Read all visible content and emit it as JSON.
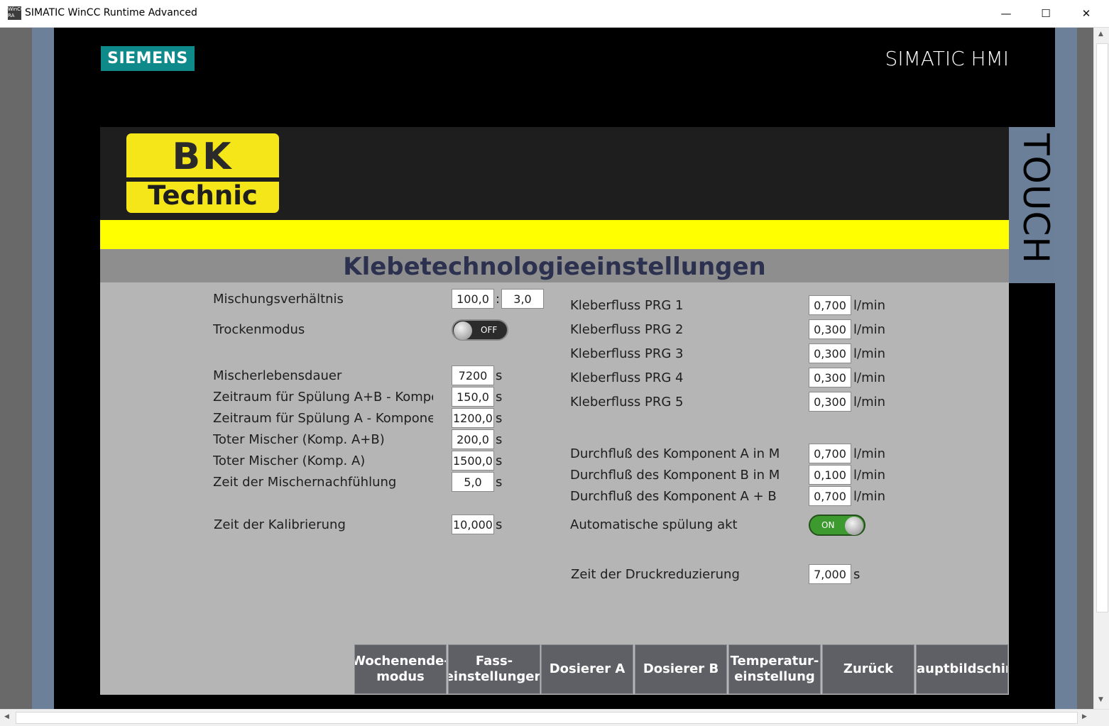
{
  "window": {
    "app_icon_text": "WinCC RA",
    "title": "SIMATIC WinCC Runtime Advanced",
    "minimize": "—",
    "maximize": "☐",
    "close": "✕"
  },
  "panel": {
    "brand": "SIEMENS",
    "product": "SIMATIC HMI",
    "touch_label": "TOUCH"
  },
  "logo": {
    "top": "BK",
    "bottom": "Technic"
  },
  "page_title": "Klebetechnologieeinstellungen",
  "left": {
    "mix_label": "Mischungsverhältnis",
    "mix_a": "100,0",
    "mix_sep": ":",
    "mix_b": "3,0",
    "dry_label": "Trockenmodus",
    "dry_state": "OFF",
    "rows": [
      {
        "label": "Mischerlebensdauer",
        "value": "7200",
        "unit": "s"
      },
      {
        "label": "Zeitraum für Spülung A+B - Kompor",
        "value": "150,0",
        "unit": "s"
      },
      {
        "label": "Zeitraum für Spülung A - Kompone",
        "value": "1200,0",
        "unit": "s"
      },
      {
        "label": "Toter Mischer (Komp. A+B)",
        "value": "200,0",
        "unit": "s"
      },
      {
        "label": "Toter Mischer (Komp. A)",
        "value": "1500,0",
        "unit": "s"
      },
      {
        "label": "Zeit der Mischernachfühlung",
        "value": "5,0",
        "unit": "s"
      }
    ],
    "calib_label": "Zeit der Kalibrierung",
    "calib_value": "10,000",
    "calib_unit": "s"
  },
  "right": {
    "flows": [
      {
        "label": "Kleberfluss PRG 1",
        "value": "0,700",
        "unit": "l/min"
      },
      {
        "label": "Kleberfluss PRG 2",
        "value": "0,300",
        "unit": "l/min"
      },
      {
        "label": "Kleberfluss PRG 3",
        "value": "0,300",
        "unit": "l/min"
      },
      {
        "label": "Kleberfluss PRG 4",
        "value": "0,300",
        "unit": "l/min"
      },
      {
        "label": "Kleberfluss PRG 5",
        "value": "0,300",
        "unit": "l/min"
      }
    ],
    "through": [
      {
        "label": "Durchfluß des Komponent A in Mar",
        "value": "0,700",
        "unit": "l/min"
      },
      {
        "label": "Durchfluß des Komponent B in Mar",
        "value": "0,100",
        "unit": "l/min"
      },
      {
        "label": "Durchfluß des Komponent A + B in",
        "value": "0,700",
        "unit": "l/min"
      }
    ],
    "auto_label": "Automatische spülung aktivi",
    "auto_state": "ON",
    "press_label": "Zeit der Druckreduzierung",
    "press_value": "7,000",
    "press_unit": "s"
  },
  "nav": {
    "weekend": "Wochenende-\nmodus",
    "barrel": "Fass-\neinstellungen",
    "dosA": "Dosierer A",
    "dosB": "Dosierer B",
    "temp": "Temperatur-\neinstellung",
    "back": "Zurück",
    "main": "auptbildschiı"
  }
}
